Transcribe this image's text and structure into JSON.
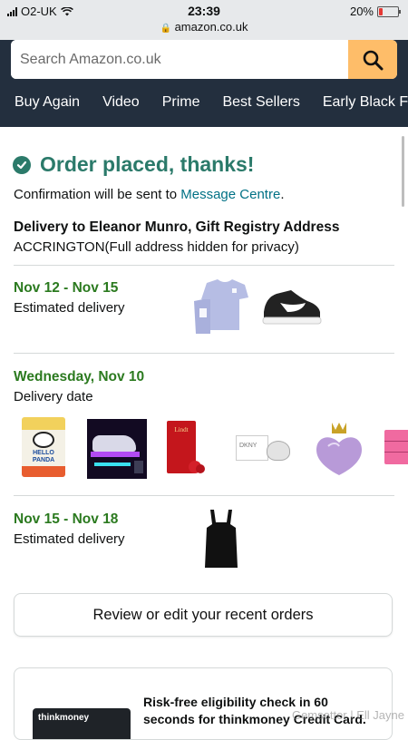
{
  "status_bar": {
    "carrier": "O2-UK",
    "time": "23:39",
    "url": "amazon.co.uk",
    "battery": "20%",
    "battery_level": 0.2
  },
  "search": {
    "placeholder": "Search Amazon.co.uk"
  },
  "nav": {
    "items": [
      "Buy Again",
      "Video",
      "Prime",
      "Best Sellers",
      "Early Black Frid"
    ]
  },
  "confirmation": {
    "title": "Order placed, thanks!",
    "sent_prefix": "Confirmation will be sent to ",
    "sent_link": "Message Centre",
    "sent_suffix": "."
  },
  "delivery": {
    "heading": "Delivery to Eleanor Munro, Gift Registry Address",
    "address": "ACCRINGTON(Full address hidden for privacy)"
  },
  "shipments": [
    {
      "date": "Nov 12 - Nov 15",
      "label": "Estimated delivery",
      "items": [
        "t-shirt-thumbnail",
        "sneaker-thumbnail"
      ]
    },
    {
      "date": "Wednesday, Nov 10",
      "label": "Delivery date",
      "items": [
        "hello-panda-thumbnail",
        "car-led-kit-thumbnail",
        "lindor-box-thumbnail",
        "dkny-perfume-thumbnail",
        "princess-perfume-thumbnail",
        "pink-toolbox-thumbnail"
      ]
    },
    {
      "date": "Nov 15 - Nov 18",
      "label": "Estimated delivery",
      "items": [
        "apron-thumbnail"
      ]
    }
  ],
  "product_text": {
    "hello_panda": "HELLO PANDA",
    "lindt": "Lindt",
    "dkny": "DKNY"
  },
  "review_button": "Review or edit your recent orders",
  "promo": {
    "card_brand": "thinkmoney",
    "text": "Risk-free eligibility check in 60 seconds for thinkmoney Credit Card."
  },
  "watermark": "Gemsetter | Ell Jayne",
  "colors": {
    "header_bg": "#232f3e",
    "search_button": "#febd69",
    "success_green": "#2b7a6a",
    "date_green": "#2b7a1f",
    "link_teal": "#007185"
  }
}
